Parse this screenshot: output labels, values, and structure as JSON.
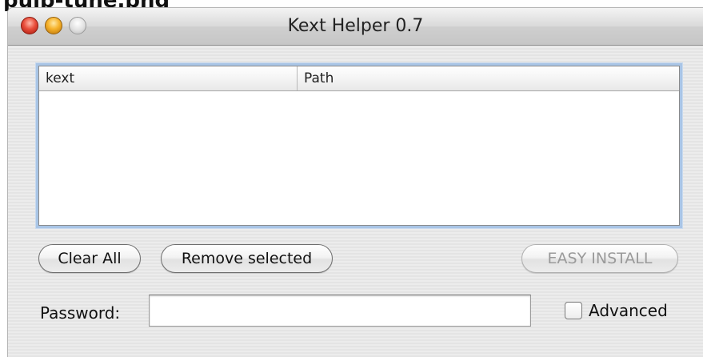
{
  "caption": "pulp-tune.png",
  "window": {
    "title": "Kext Helper 0.7"
  },
  "table": {
    "columns": [
      "kext",
      "Path"
    ],
    "rows": []
  },
  "buttons": {
    "clear_all": "Clear All",
    "remove_selected": "Remove selected",
    "easy_install": "EASY INSTALL"
  },
  "password": {
    "label": "Password:",
    "value": "",
    "placeholder": ""
  },
  "advanced": {
    "label": "Advanced",
    "checked": false
  },
  "colors": {
    "close": "#e84d3a",
    "minimize": "#f6b22a",
    "zoom": "#d0d0d0",
    "focus_ring": "#a9c5e6",
    "disabled_text": "#9a9a9a"
  },
  "icons": [
    "close-traffic-light",
    "minimize-traffic-light",
    "zoom-traffic-light"
  ]
}
